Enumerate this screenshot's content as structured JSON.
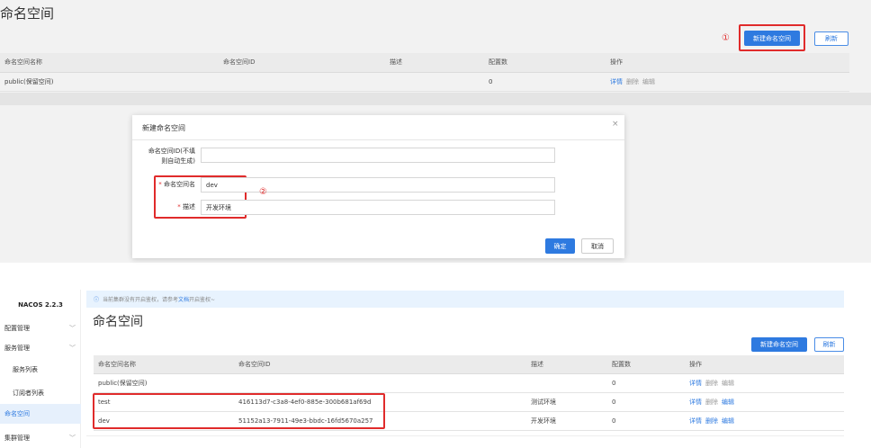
{
  "top": {
    "title": "命名空间",
    "marker1": "①",
    "new_button": "新建命名空间",
    "refresh_button": "刷新",
    "table": {
      "columns": [
        "命名空间名称",
        "命名空间ID",
        "描述",
        "配置数",
        "操作"
      ],
      "rows": [
        {
          "name": "public(保留空间)",
          "id": "",
          "desc": "",
          "count": "0",
          "detail": "详情",
          "delete": "删除",
          "edit": "编辑"
        }
      ]
    }
  },
  "modal": {
    "title": "新建命名空间",
    "close": "×",
    "field_id_label": "命名空间ID(不填则自动生成)",
    "field_id_label_line1": "命名空间ID(不填",
    "field_id_label_line2": "则自动生成)",
    "field_id_value": "",
    "field_name_label": "命名空间名",
    "field_name_value": "dev",
    "field_desc_label": "描述",
    "field_desc_value": "开发环境",
    "required_mark": "*",
    "marker2": "②",
    "confirm": "确定",
    "cancel": "取消"
  },
  "sidebar": {
    "brand": "NACOS 2.2.3",
    "items": [
      {
        "label": "配置管理",
        "chevron": "﹀"
      },
      {
        "label": "服务管理",
        "chevron": "﹀"
      },
      {
        "label": "服务列表"
      },
      {
        "label": "订阅者列表"
      },
      {
        "label": "命名空间"
      },
      {
        "label": "集群管理",
        "chevron": "﹀"
      }
    ]
  },
  "bottom": {
    "notice_icon": "ⓘ",
    "notice_pre": "当前集群没有开启鉴权，请参考",
    "notice_link": "文档",
    "notice_post": "开启鉴权~",
    "title": "命名空间",
    "new_button": "新建命名空间",
    "refresh_button": "刷新",
    "table": {
      "columns": [
        "命名空间名称",
        "命名空间ID",
        "描述",
        "配置数",
        "操作"
      ],
      "rows": [
        {
          "name": "public(保留空间)",
          "id": "",
          "desc": "",
          "count": "0",
          "detail": "详情",
          "delete": "删除",
          "edit": "编辑"
        },
        {
          "name": "test",
          "id": "416113d7-c3a8-4ef0-885e-300b681af69d",
          "desc": "测试环境",
          "count": "0",
          "detail": "详情",
          "delete": "删除",
          "edit": "编辑"
        },
        {
          "name": "dev",
          "id": "51152a13-7911-49e3-bbdc-16fd5670a257",
          "desc": "开发环境",
          "count": "0",
          "detail": "详情",
          "delete": "删除",
          "edit": "编辑"
        }
      ]
    }
  },
  "colors": {
    "accent": "#2e7ae0",
    "highlight": "#e02b2b"
  }
}
